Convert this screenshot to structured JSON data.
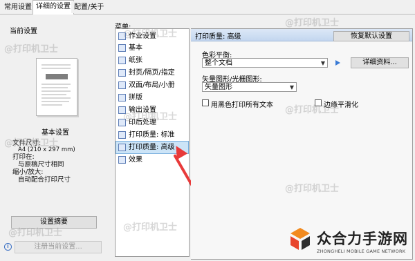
{
  "tabs": [
    "常用设置",
    "详细的设置",
    "配置/关于"
  ],
  "left_panel": {
    "title": "当前设置",
    "basic_title": "基本设置",
    "info": [
      {
        "label": "文件尺寸:",
        "value": "A4 (210 x 297 mm)"
      },
      {
        "label": "打印在:",
        "value": "与原稿尺寸相同"
      },
      {
        "label": "缩小/放大:",
        "value": "自动配合打印尺寸"
      }
    ],
    "summary_button": "设置摘要",
    "register_button": "注册当前设置..."
  },
  "menu": {
    "label": "菜单:",
    "items": [
      "作业设置",
      "基本",
      "纸张",
      "封页/隔页/指定",
      "双面/布局/小册",
      "拼版",
      "输出设置",
      "印后处理",
      "打印质量: 标准",
      "打印质量: 高级",
      "效果"
    ],
    "selected": "打印质量: 高级"
  },
  "right_panel": {
    "header": "打印质量: 高级",
    "restore_button": "恢复默认设置",
    "color_balance_label": "色彩平衡:",
    "color_balance_value": "整个文档",
    "details_button": "详细资料...",
    "vector_label": "矢量图形/光栅图形:",
    "vector_value": "矢量图形",
    "checkbox_black": "用黑色打印所有文本",
    "checkbox_smooth": "边缘平滑化"
  },
  "watermarks": [
    "@打印机卫士",
    "@打印机卫士",
    "@打印机卫士",
    "@打印机卫士",
    "@打印机卫士",
    "@打印机卫士",
    "@打印机卫士",
    "@打印机卫士",
    "@打印机卫士"
  ],
  "brand": {
    "name": "众合力手游网",
    "subtitle": "ZHONGHELI MOBILE GAME NETWORK"
  },
  "colors": {
    "selection": "#cce4f7",
    "header": "#c3d6ef",
    "arrow": "#e83a3a",
    "accent": "#3a7bd5"
  }
}
